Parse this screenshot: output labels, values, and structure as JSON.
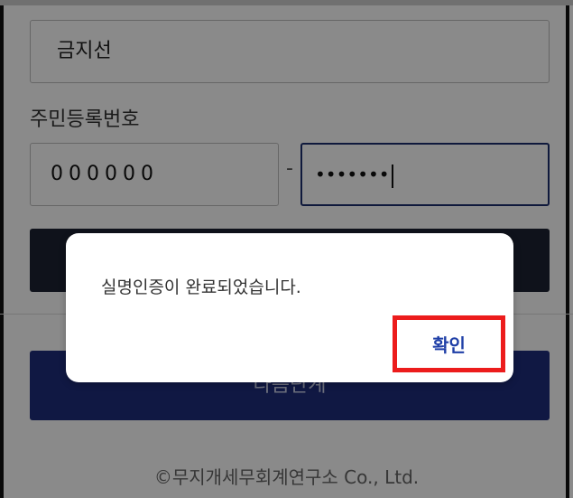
{
  "form": {
    "name_value": "금지선",
    "rrn_label": "주민등록번호",
    "rrn_front_value": "000000",
    "rrn_separator": "-",
    "rrn_back_value": "•••••••"
  },
  "next_button_label": "다음단계",
  "footer": {
    "copyright": "©무지개세무회계연구소 Co., Ltd."
  },
  "dialog": {
    "message": "실명인증이 완료되었습니다.",
    "confirm_label": "확인"
  },
  "colors": {
    "primary_navy": "#1f2e7c",
    "dark_button": "#1d2233",
    "highlight_red": "#ec1c1c",
    "confirm_text": "#1f3fa7"
  }
}
